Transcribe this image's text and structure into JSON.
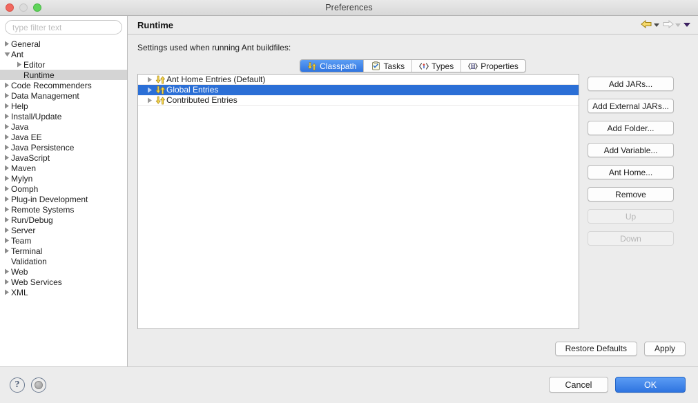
{
  "window": {
    "title": "Preferences",
    "traffic_lights": [
      {
        "name": "close",
        "color": "#f0685f"
      },
      {
        "name": "minimize",
        "color": "#dcdcdc"
      },
      {
        "name": "maximize",
        "color": "#5fd45a"
      }
    ]
  },
  "sidebar": {
    "filter": {
      "value": "",
      "placeholder": "type filter text"
    },
    "items": [
      {
        "label": "General",
        "level": 1,
        "expandable": true,
        "expanded": false,
        "selected": false
      },
      {
        "label": "Ant",
        "level": 1,
        "expandable": true,
        "expanded": true,
        "selected": false
      },
      {
        "label": "Editor",
        "level": 2,
        "expandable": true,
        "expanded": false,
        "selected": false
      },
      {
        "label": "Runtime",
        "level": 2,
        "expandable": false,
        "expanded": false,
        "selected": true
      },
      {
        "label": "Code Recommenders",
        "level": 1,
        "expandable": true,
        "expanded": false,
        "selected": false
      },
      {
        "label": "Data Management",
        "level": 1,
        "expandable": true,
        "expanded": false,
        "selected": false
      },
      {
        "label": "Help",
        "level": 1,
        "expandable": true,
        "expanded": false,
        "selected": false
      },
      {
        "label": "Install/Update",
        "level": 1,
        "expandable": true,
        "expanded": false,
        "selected": false
      },
      {
        "label": "Java",
        "level": 1,
        "expandable": true,
        "expanded": false,
        "selected": false
      },
      {
        "label": "Java EE",
        "level": 1,
        "expandable": true,
        "expanded": false,
        "selected": false
      },
      {
        "label": "Java Persistence",
        "level": 1,
        "expandable": true,
        "expanded": false,
        "selected": false
      },
      {
        "label": "JavaScript",
        "level": 1,
        "expandable": true,
        "expanded": false,
        "selected": false
      },
      {
        "label": "Maven",
        "level": 1,
        "expandable": true,
        "expanded": false,
        "selected": false
      },
      {
        "label": "Mylyn",
        "level": 1,
        "expandable": true,
        "expanded": false,
        "selected": false
      },
      {
        "label": "Oomph",
        "level": 1,
        "expandable": true,
        "expanded": false,
        "selected": false
      },
      {
        "label": "Plug-in Development",
        "level": 1,
        "expandable": true,
        "expanded": false,
        "selected": false
      },
      {
        "label": "Remote Systems",
        "level": 1,
        "expandable": true,
        "expanded": false,
        "selected": false
      },
      {
        "label": "Run/Debug",
        "level": 1,
        "expandable": true,
        "expanded": false,
        "selected": false
      },
      {
        "label": "Server",
        "level": 1,
        "expandable": true,
        "expanded": false,
        "selected": false
      },
      {
        "label": "Team",
        "level": 1,
        "expandable": true,
        "expanded": false,
        "selected": false
      },
      {
        "label": "Terminal",
        "level": 1,
        "expandable": true,
        "expanded": false,
        "selected": false
      },
      {
        "label": "Validation",
        "level": 1,
        "expandable": false,
        "expanded": false,
        "selected": false
      },
      {
        "label": "Web",
        "level": 1,
        "expandable": true,
        "expanded": false,
        "selected": false
      },
      {
        "label": "Web Services",
        "level": 1,
        "expandable": true,
        "expanded": false,
        "selected": false
      },
      {
        "label": "XML",
        "level": 1,
        "expandable": true,
        "expanded": false,
        "selected": false
      }
    ]
  },
  "main": {
    "title": "Runtime",
    "nav": {
      "back_icon": "back-arrow-icon",
      "forward_icon": "forward-arrow-icon",
      "menu_icon": "dropdown-triangle-icon"
    },
    "intro": "Settings used when running Ant buildfiles:",
    "tabs": [
      {
        "label": "Classpath",
        "icon": "classpath-icon",
        "active": true
      },
      {
        "label": "Tasks",
        "icon": "tasks-icon",
        "active": false
      },
      {
        "label": "Types",
        "icon": "types-icon",
        "active": false
      },
      {
        "label": "Properties",
        "icon": "properties-icon",
        "active": false
      }
    ],
    "classpath_entries": [
      {
        "label": "Ant Home Entries (Default)",
        "icon": "classpath-entry-icon",
        "selected": false,
        "expandable": true
      },
      {
        "label": "Global Entries",
        "icon": "classpath-entry-icon",
        "selected": true,
        "expandable": true
      },
      {
        "label": "Contributed Entries",
        "icon": "classpath-entry-icon",
        "selected": false,
        "expandable": true
      }
    ],
    "side_buttons": [
      {
        "label": "Add JARs...",
        "disabled": false
      },
      {
        "label": "Add External JARs...",
        "disabled": false
      },
      {
        "label": "Add Folder...",
        "disabled": false
      },
      {
        "label": "Add Variable...",
        "disabled": false
      },
      {
        "label": "Ant Home...",
        "disabled": false
      },
      {
        "label": "Remove",
        "disabled": false
      },
      {
        "label": "Up",
        "disabled": true
      },
      {
        "label": "Down",
        "disabled": true
      }
    ],
    "restore_defaults_label": "Restore Defaults",
    "apply_label": "Apply"
  },
  "footer": {
    "help_icon": "help-question-icon",
    "apply_close_icon": "round-dot-icon",
    "cancel_label": "Cancel",
    "ok_label": "OK"
  },
  "colors": {
    "selection_blue": "#2b6fd6",
    "primary_button": "#2f74e0",
    "entry_icon_gold": "#f2c21c",
    "window_bg": "#ececec"
  }
}
